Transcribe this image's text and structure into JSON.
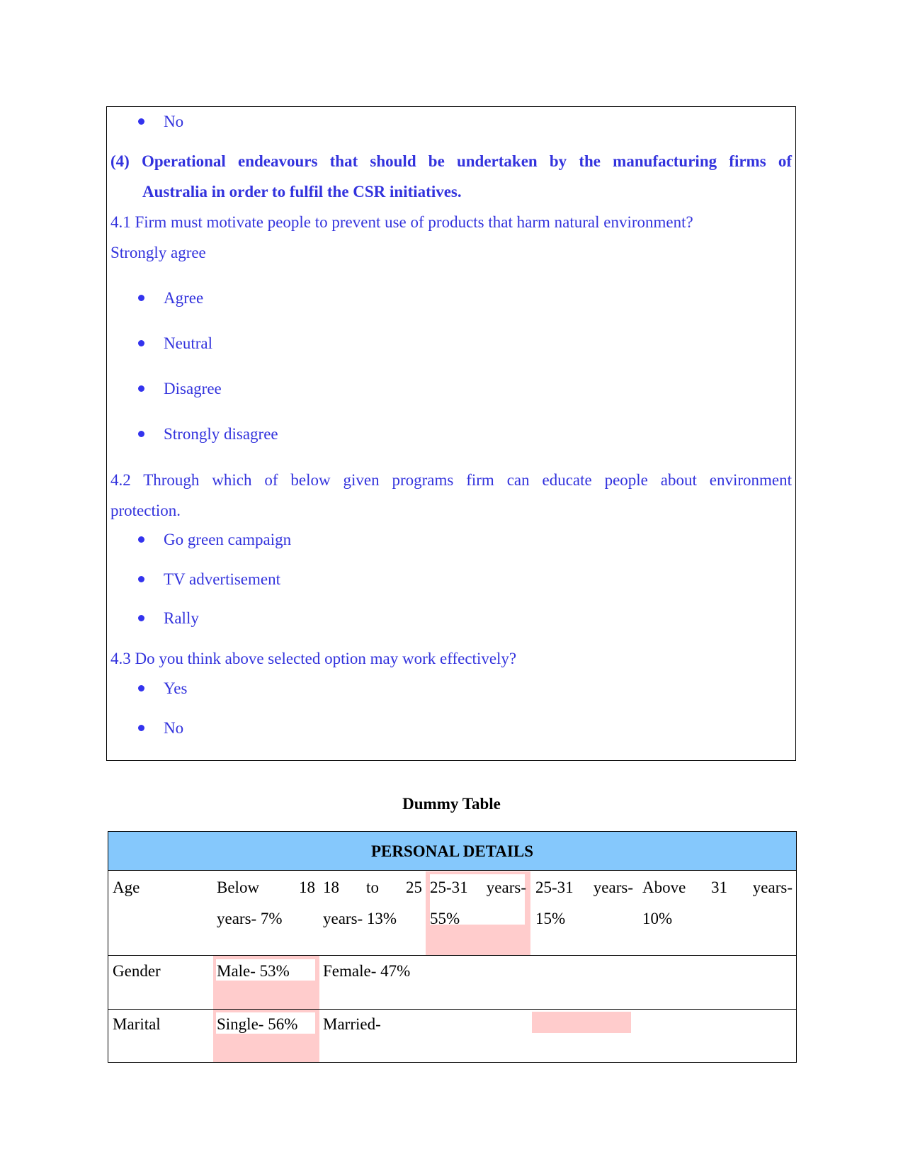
{
  "questionnaire": {
    "prev_option": "No",
    "section_heading_line1": "(4) Operational endeavours that should be undertaken by the manufacturing firms of",
    "section_heading_line2": "Australia in order to fulfil the CSR initiatives.",
    "q41": {
      "question": "4.1 Firm must motivate people to prevent use of products that harm natural environment?",
      "first_option": "Strongly agree",
      "options": [
        "Agree",
        "Neutral",
        "Disagree",
        "Strongly disagree"
      ]
    },
    "q42": {
      "question_line1": "4.2 Through which of below given programs firm can educate people about environment",
      "question_line2": "protection.",
      "options": [
        "Go green campaign",
        "TV advertisement",
        "Rally"
      ]
    },
    "q43": {
      "question": "4.3 Do you think above selected option may work effectively?",
      "options": [
        "Yes",
        "No"
      ]
    }
  },
  "table": {
    "caption": "Dummy Table",
    "header": "PERSONAL DETAILS",
    "rows": [
      {
        "label": "Age",
        "cells": [
          [
            "Below 18",
            "years- 7%"
          ],
          [
            "18 to 25",
            "years- 13%"
          ],
          [
            "25-31 years-",
            "55%"
          ],
          [
            "25-31 years-",
            "15%"
          ],
          [
            "Above 31 years-",
            "10%"
          ]
        ]
      },
      {
        "label": "Gender",
        "cells": [
          "Male- 53%",
          "Female- 47%"
        ]
      },
      {
        "label": "Marital",
        "cells": [
          "Single- 56%",
          "Married-"
        ]
      }
    ],
    "highlight_color": "#ffcccc",
    "header_color": "#85c8fc"
  },
  "colors": {
    "question_text": "#3333dd"
  }
}
